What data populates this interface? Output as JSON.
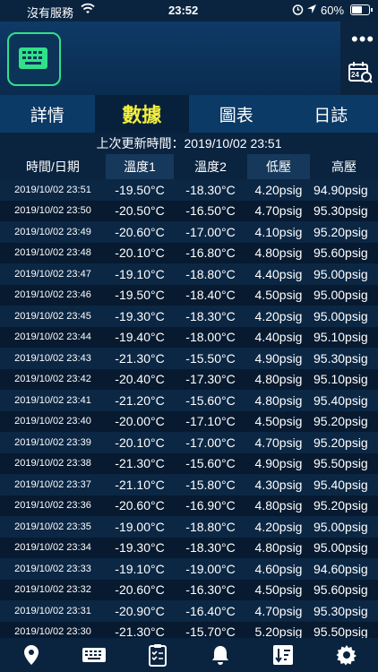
{
  "status_bar": {
    "carrier": "沒有服務",
    "time": "23:52",
    "battery": "60%",
    "battery_level": 0.6
  },
  "header": {
    "left_icon": "keyboard-icon",
    "more_icon": "more-dots-icon",
    "calendar_icon": "calendar-search-icon",
    "calendar_label": "24"
  },
  "tabs": [
    {
      "label": "詳情"
    },
    {
      "label": "數據"
    },
    {
      "label": "圖表"
    },
    {
      "label": "日誌"
    }
  ],
  "active_tab": 1,
  "last_updated": "上次更新時間：2019/10/02 23:51",
  "table": {
    "columns": [
      "時間/日期",
      "溫度1",
      "溫度2",
      "低壓",
      "高壓"
    ],
    "rows": [
      [
        "2019/10/02 23:51",
        "-19.50°C",
        "-18.30°C",
        "4.20psig",
        "94.90psig"
      ],
      [
        "2019/10/02 23:50",
        "-20.50°C",
        "-16.50°C",
        "4.70psig",
        "95.30psig"
      ],
      [
        "2019/10/02 23:49",
        "-20.60°C",
        "-17.00°C",
        "4.10psig",
        "95.20psig"
      ],
      [
        "2019/10/02 23:48",
        "-20.10°C",
        "-16.80°C",
        "4.80psig",
        "95.60psig"
      ],
      [
        "2019/10/02 23:47",
        "-19.10°C",
        "-18.80°C",
        "4.40psig",
        "95.00psig"
      ],
      [
        "2019/10/02 23:46",
        "-19.50°C",
        "-18.40°C",
        "4.50psig",
        "95.00psig"
      ],
      [
        "2019/10/02 23:45",
        "-19.30°C",
        "-18.30°C",
        "4.20psig",
        "95.00psig"
      ],
      [
        "2019/10/02 23:44",
        "-19.40°C",
        "-18.00°C",
        "4.40psig",
        "95.10psig"
      ],
      [
        "2019/10/02 23:43",
        "-21.30°C",
        "-15.50°C",
        "4.90psig",
        "95.30psig"
      ],
      [
        "2019/10/02 23:42",
        "-20.40°C",
        "-17.30°C",
        "4.80psig",
        "95.10psig"
      ],
      [
        "2019/10/02 23:41",
        "-21.20°C",
        "-15.60°C",
        "4.80psig",
        "95.40psig"
      ],
      [
        "2019/10/02 23:40",
        "-20.00°C",
        "-17.10°C",
        "4.50psig",
        "95.20psig"
      ],
      [
        "2019/10/02 23:39",
        "-20.10°C",
        "-17.00°C",
        "4.70psig",
        "95.20psig"
      ],
      [
        "2019/10/02 23:38",
        "-21.30°C",
        "-15.60°C",
        "4.90psig",
        "95.50psig"
      ],
      [
        "2019/10/02 23:37",
        "-21.10°C",
        "-15.80°C",
        "4.30psig",
        "95.40psig"
      ],
      [
        "2019/10/02 23:36",
        "-20.60°C",
        "-16.90°C",
        "4.80psig",
        "95.20psig"
      ],
      [
        "2019/10/02 23:35",
        "-19.00°C",
        "-18.80°C",
        "4.20psig",
        "95.00psig"
      ],
      [
        "2019/10/02 23:34",
        "-19.30°C",
        "-18.30°C",
        "4.80psig",
        "95.00psig"
      ],
      [
        "2019/10/02 23:33",
        "-19.10°C",
        "-19.00°C",
        "4.60psig",
        "94.60psig"
      ],
      [
        "2019/10/02 23:32",
        "-20.60°C",
        "-16.30°C",
        "4.50psig",
        "95.60psig"
      ],
      [
        "2019/10/02 23:31",
        "-20.90°C",
        "-16.40°C",
        "4.70psig",
        "95.30psig"
      ],
      [
        "2019/10/02 23:30",
        "-21.30°C",
        "-15.70°C",
        "5.20psig",
        "95.50psig"
      ]
    ]
  },
  "bottom_nav": [
    {
      "icon": "location-pin-icon"
    },
    {
      "icon": "keyboard-icon"
    },
    {
      "icon": "clipboard-checklist-icon"
    },
    {
      "icon": "bell-icon"
    },
    {
      "icon": "sort-list-icon"
    },
    {
      "icon": "gear-icon"
    }
  ],
  "colors": {
    "accent_green": "#31e08a",
    "active_tab_text": "#f4ef3c",
    "header_blue": "#0c3a66",
    "background": "#06182c"
  }
}
